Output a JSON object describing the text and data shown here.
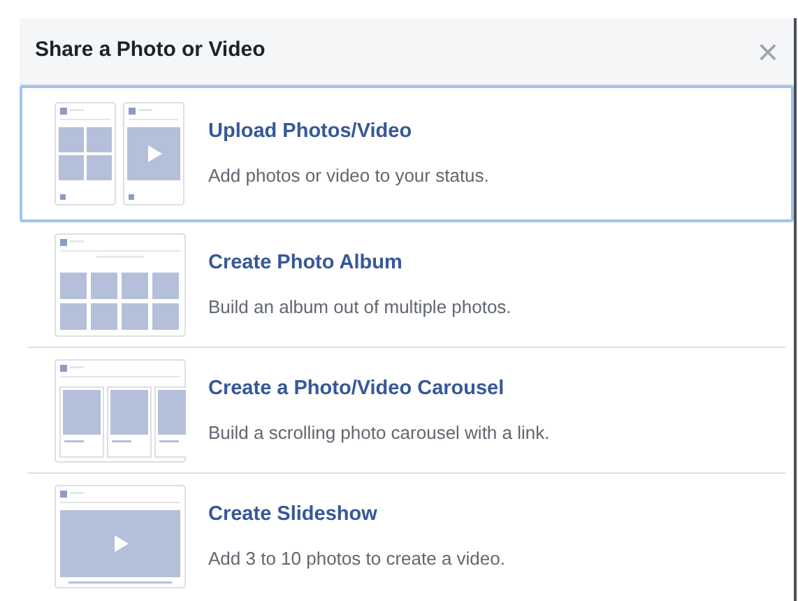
{
  "dialog": {
    "title": "Share a Photo or Video",
    "close": "×"
  },
  "options": [
    {
      "kind": "upload",
      "title": "Upload Photos/Video",
      "description": "Add photos or video to your status.",
      "selected": true
    },
    {
      "kind": "album",
      "title": "Create Photo Album",
      "description": "Build an album out of multiple photos.",
      "selected": false
    },
    {
      "kind": "carousel",
      "title": "Create a Photo/Video Carousel",
      "description": "Build a scrolling photo carousel with a link.",
      "selected": false
    },
    {
      "kind": "slideshow",
      "title": "Create Slideshow",
      "description": "Add 3 to 10 photos to create a video.",
      "selected": false
    }
  ]
}
